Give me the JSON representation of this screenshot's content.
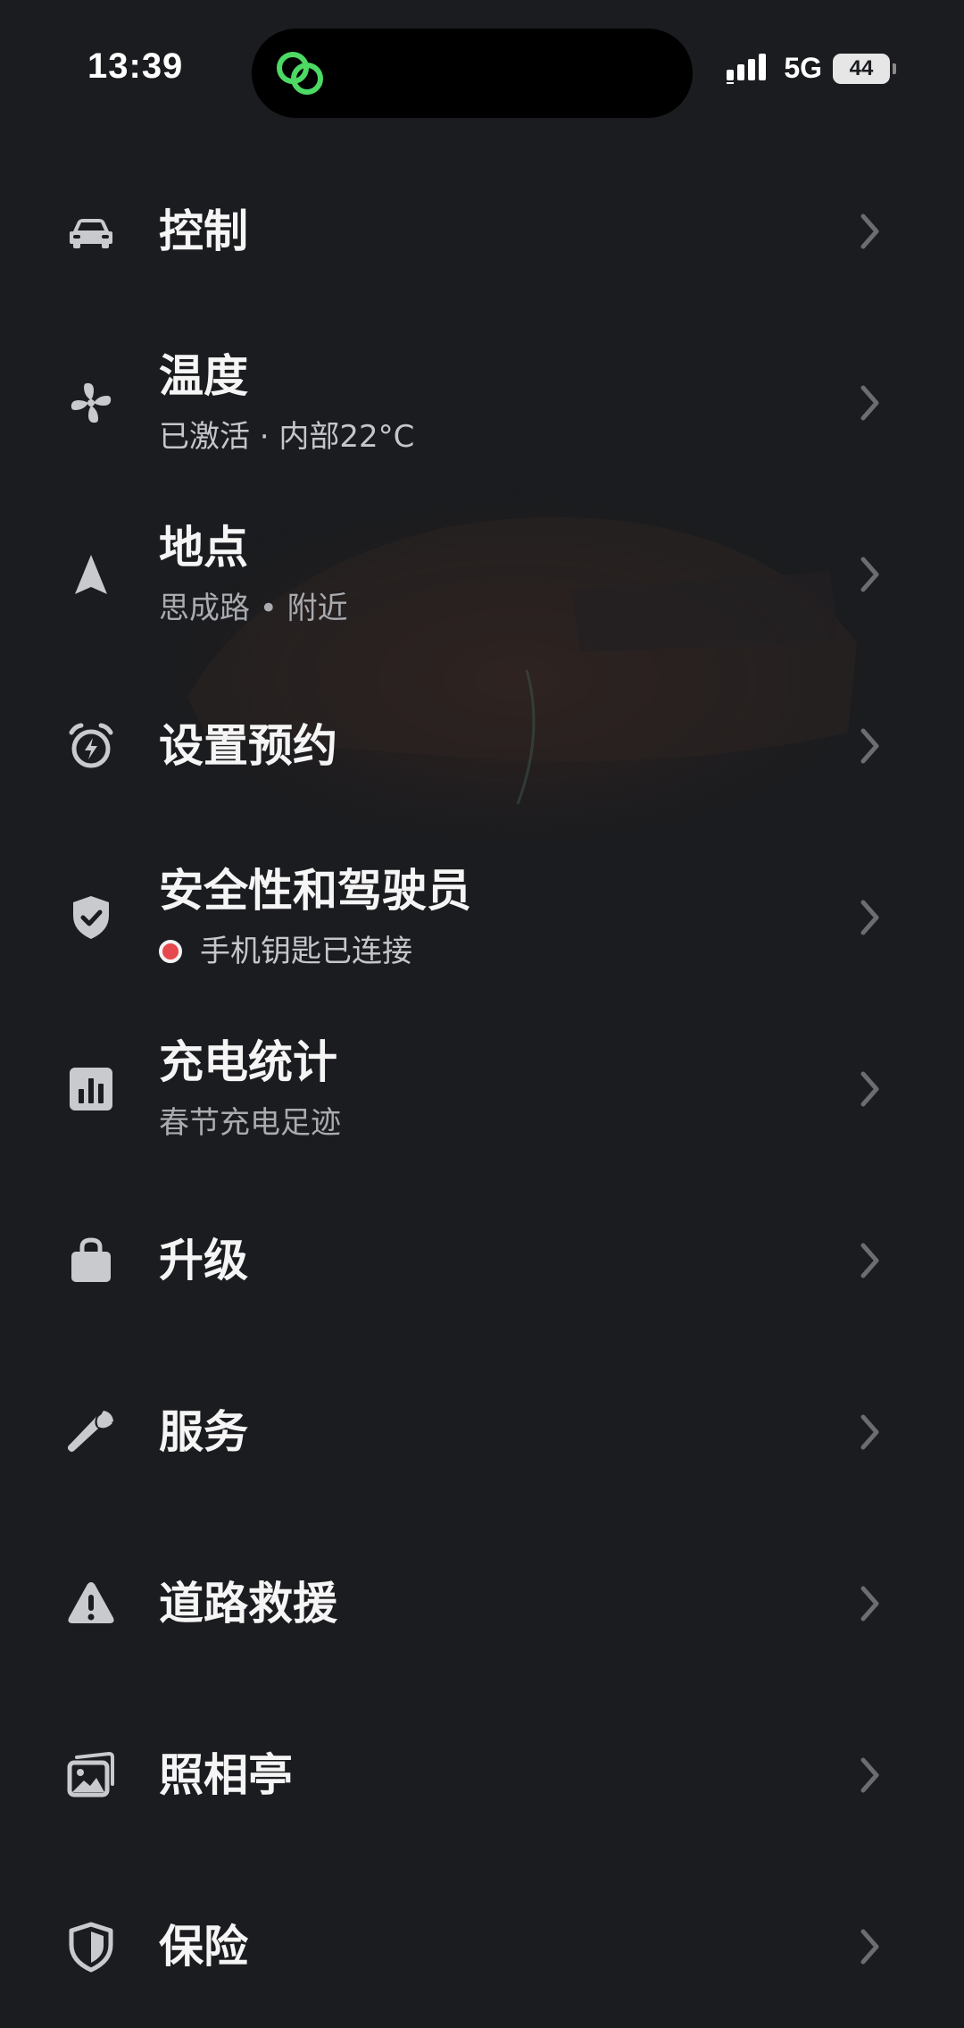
{
  "status_bar": {
    "time": "13:39",
    "network": "5G",
    "battery": "44",
    "island_icon": "green-link-icon",
    "signal_icon": "signal-bars-icon"
  },
  "menu": {
    "items": [
      {
        "label": "控制",
        "subtitle": "",
        "icon": "car-icon"
      },
      {
        "label": "温度",
        "subtitle": "已激活 · 内部22°C",
        "icon": "fan-icon"
      },
      {
        "label": "地点",
        "subtitle": "思成路 • 附近",
        "icon": "navigation-arrow-icon"
      },
      {
        "label": "设置预约",
        "subtitle": "",
        "icon": "alarm-bolt-icon"
      },
      {
        "label": "安全性和驾驶员",
        "subtitle": "手机钥匙已连接",
        "icon": "shield-check-icon"
      },
      {
        "label": "充电统计",
        "subtitle": "春节充电足迹",
        "icon": "bar-chart-icon"
      },
      {
        "label": "升级",
        "subtitle": "",
        "icon": "shopping-bag-icon"
      },
      {
        "label": "服务",
        "subtitle": "",
        "icon": "wrench-icon"
      },
      {
        "label": "道路救援",
        "subtitle": "",
        "icon": "warning-triangle-icon"
      },
      {
        "label": "照相亭",
        "subtitle": "",
        "icon": "photo-booth-icon"
      },
      {
        "label": "保险",
        "subtitle": "",
        "icon": "insurance-shield-icon"
      }
    ]
  },
  "colors": {
    "background": "#1b1c1f",
    "text_primary": "#f5f5f5",
    "text_secondary": "#a9abb0",
    "icon": "#c9cacd",
    "chevron": "#6b6d72",
    "status_dot": "#e5484d",
    "island_accent": "#4cd964"
  }
}
